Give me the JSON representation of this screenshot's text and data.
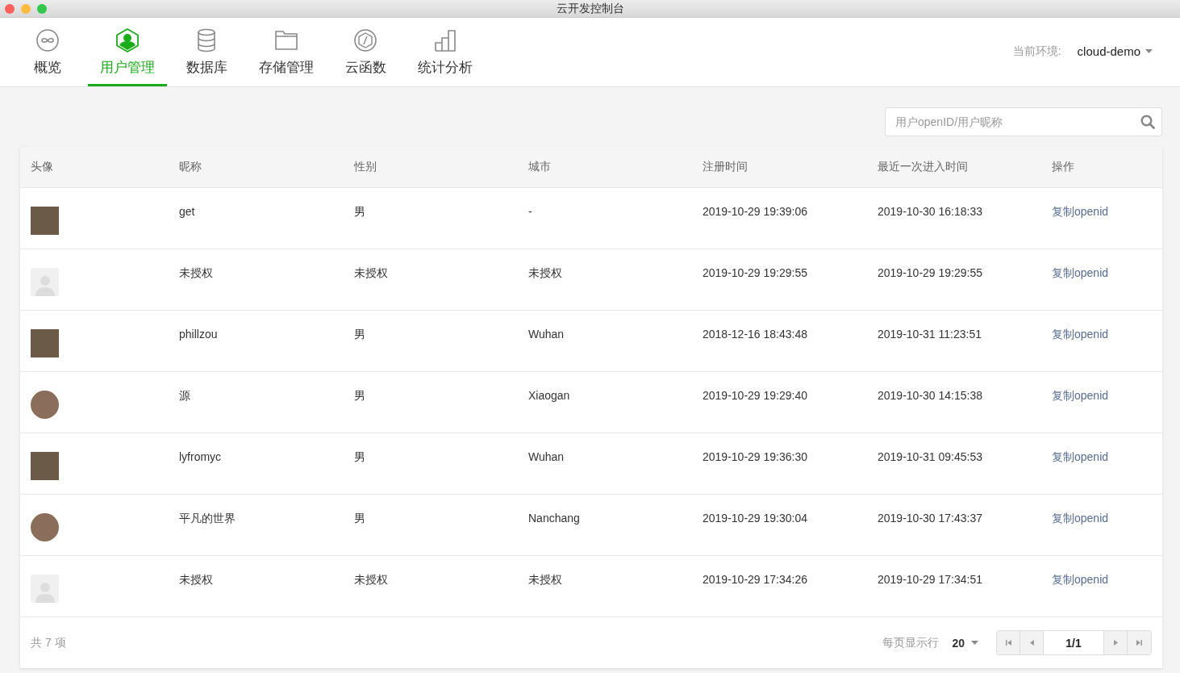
{
  "window": {
    "title": "云开发控制台"
  },
  "nav": [
    {
      "label": "概览",
      "kind": "overview",
      "selected": false
    },
    {
      "label": "用户管理",
      "kind": "user",
      "selected": true
    },
    {
      "label": "数据库",
      "kind": "database",
      "selected": false
    },
    {
      "label": "存储管理",
      "kind": "folder",
      "selected": false
    },
    {
      "label": "云函数",
      "kind": "function",
      "selected": false
    },
    {
      "label": "统计分析",
      "kind": "chart",
      "selected": false
    }
  ],
  "environment": {
    "label": "当前环境:",
    "value": "cloud-demo"
  },
  "search": {
    "placeholder": "用户openID/用户昵称"
  },
  "table": {
    "columns": [
      "头像",
      "昵称",
      "性别",
      "城市",
      "注册时间",
      "最近一次进入时间",
      "操作"
    ],
    "rows": [
      {
        "kind": "photo",
        "nickname": "get",
        "gender": "男",
        "city": "-",
        "registered": "2019-10-29 19:39:06",
        "last_visit": "2019-10-30 16:18:33",
        "action": "复制openid"
      },
      {
        "kind": "default",
        "nickname": "未授权",
        "gender": "未授权",
        "city": "未授权",
        "registered": "2019-10-29 19:29:55",
        "last_visit": "2019-10-29 19:29:55",
        "action": "复制openid"
      },
      {
        "kind": "photo",
        "nickname": "phillzou",
        "gender": "男",
        "city": "Wuhan",
        "registered": "2018-12-16 18:43:48",
        "last_visit": "2019-10-31 11:23:51",
        "action": "复制openid"
      },
      {
        "kind": "photo-round",
        "nickname": "源",
        "gender": "男",
        "city": "Xiaogan",
        "registered": "2019-10-29 19:29:40",
        "last_visit": "2019-10-30 14:15:38",
        "action": "复制openid"
      },
      {
        "kind": "photo",
        "nickname": "lyfromyc",
        "gender": "男",
        "city": "Wuhan",
        "registered": "2019-10-29 19:36:30",
        "last_visit": "2019-10-31 09:45:53",
        "action": "复制openid"
      },
      {
        "kind": "photo-round",
        "nickname": "平凡的世界",
        "gender": "男",
        "city": "Nanchang",
        "registered": "2019-10-29 19:30:04",
        "last_visit": "2019-10-30 17:43:37",
        "action": "复制openid"
      },
      {
        "kind": "default",
        "nickname": "未授权",
        "gender": "未授权",
        "city": "未授权",
        "registered": "2019-10-29 17:34:26",
        "last_visit": "2019-10-29 17:34:51",
        "action": "复制openid"
      }
    ]
  },
  "footer": {
    "total": "共 7 项",
    "page_size_label": "每页显示行",
    "page_size": "20",
    "page": "1/1"
  }
}
